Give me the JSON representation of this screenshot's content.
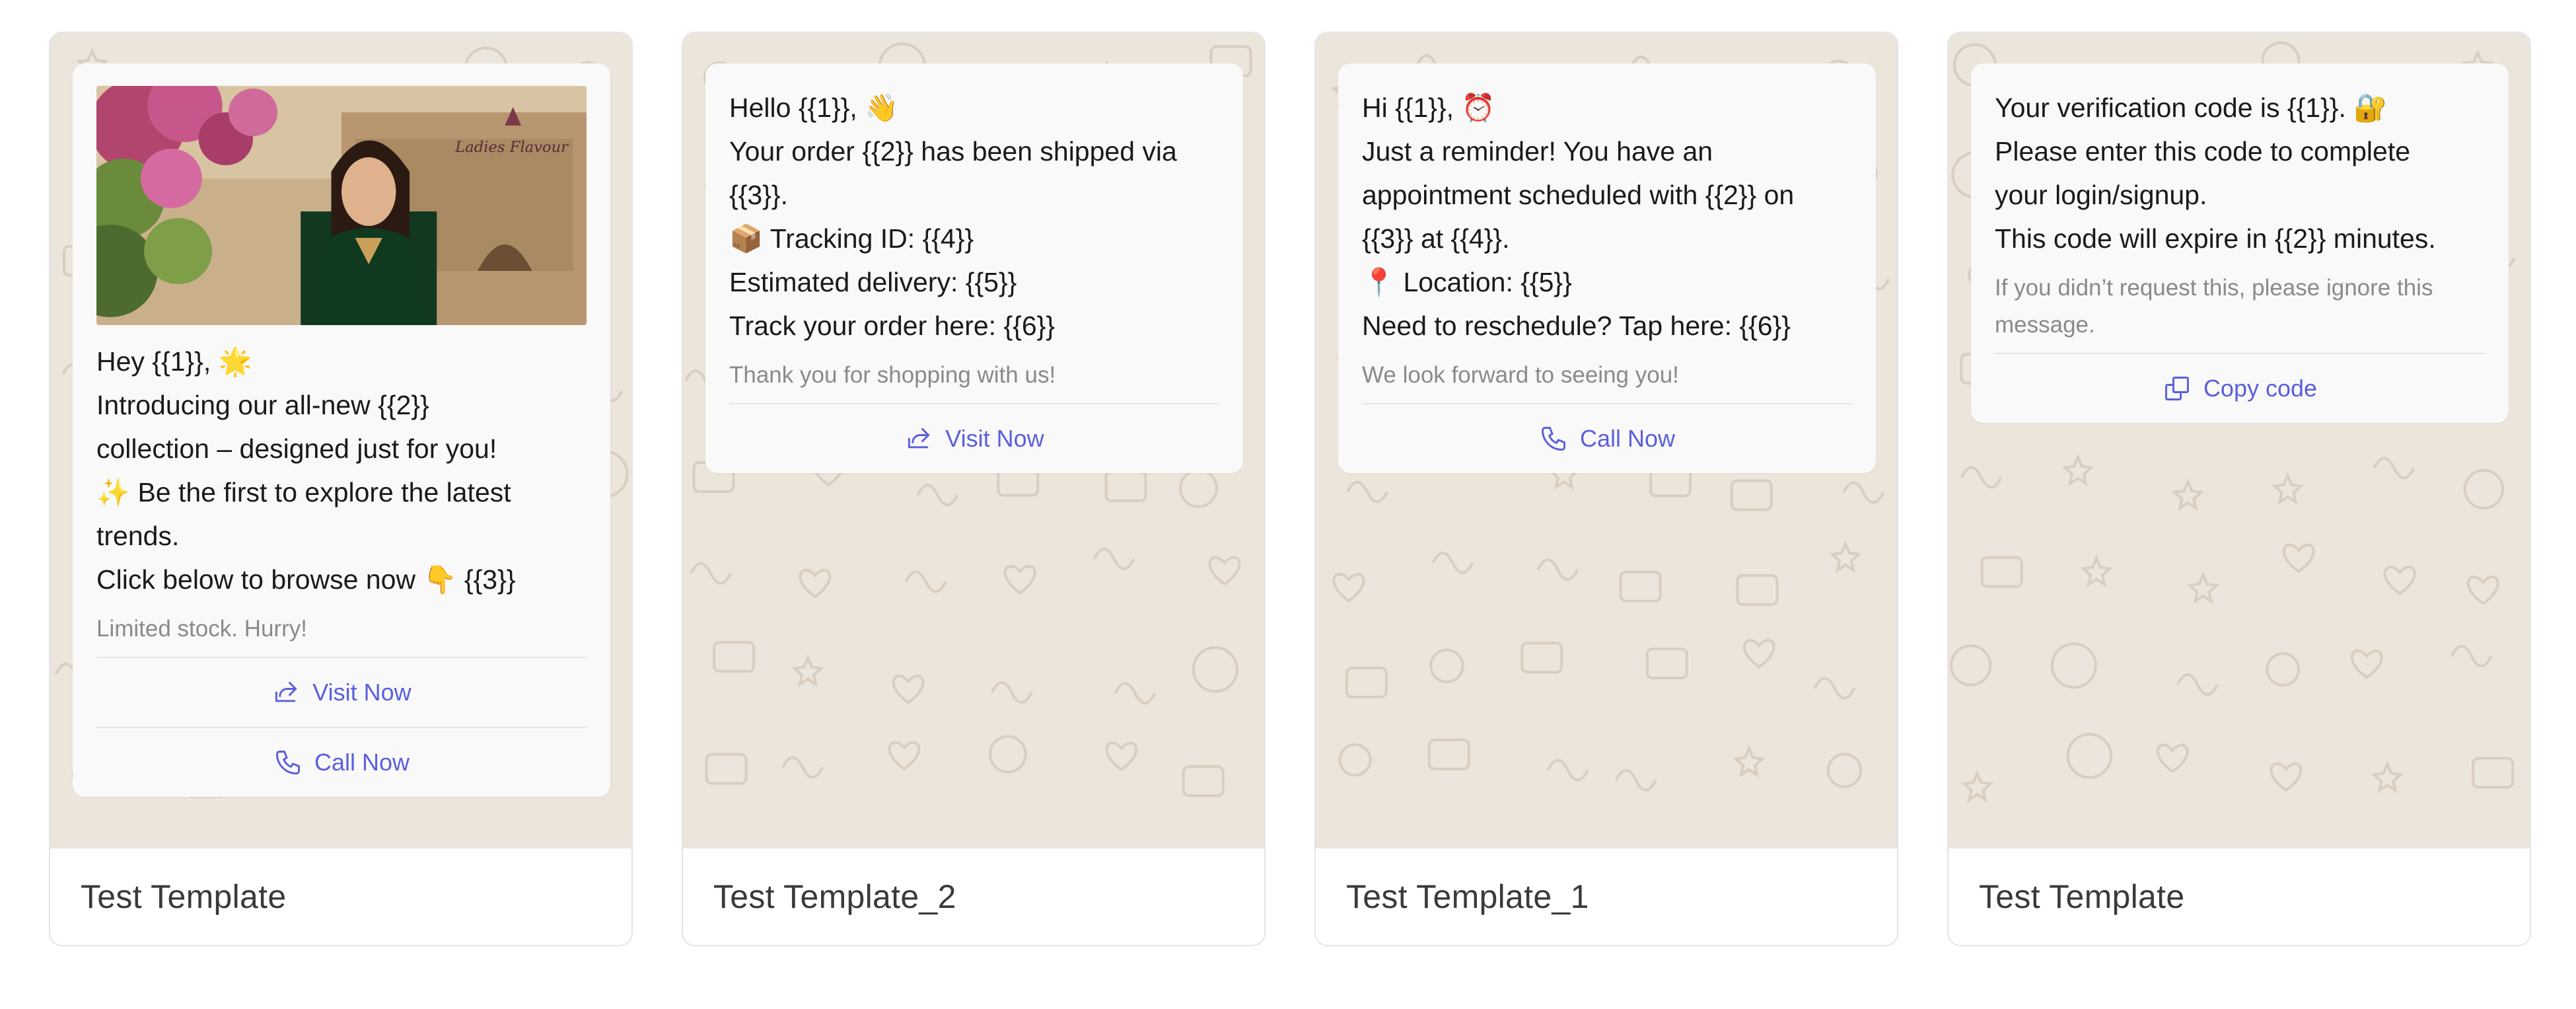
{
  "templates": [
    {
      "name": "Test Template",
      "has_image": true,
      "image_logo_text": "Ladies Flavour",
      "body": "Hey {{1}}, 🌟\nIntroducing our all-new {{2}}\ncollection – designed just for you!\n✨ Be the first to explore the latest\ntrends.\nClick below to browse now 👇 {{3}}",
      "footer": "Limited stock. Hurry!",
      "buttons": [
        {
          "label": "Visit Now",
          "icon": "external-link-icon"
        },
        {
          "label": "Call Now",
          "icon": "phone-icon"
        }
      ]
    },
    {
      "name": "Test Template_2",
      "has_image": false,
      "body": "Hello {{1}}, 👋\nYour order {{2}} has been shipped via\n{{3}}.\n📦 Tracking ID: {{4}}\nEstimated delivery: {{5}}\nTrack your order here: {{6}}",
      "footer": "Thank you for shopping with us!",
      "buttons": [
        {
          "label": "Visit Now",
          "icon": "external-link-icon"
        }
      ]
    },
    {
      "name": "Test Template_1",
      "has_image": false,
      "body": "Hi {{1}}, ⏰\nJust a reminder! You have an\nappointment scheduled with {{2}} on\n{{3}} at {{4}}.\n📍 Location: {{5}}\nNeed to reschedule? Tap here: {{6}}",
      "footer": "We look forward to seeing you!",
      "buttons": [
        {
          "label": "Call Now",
          "icon": "phone-icon"
        }
      ]
    },
    {
      "name": "Test Template",
      "has_image": false,
      "body": "Your verification code is {{1}}. 🔐\nPlease enter this code to complete\nyour login/signup.\nThis code will expire in {{2}} minutes.",
      "footer": "If you didn’t request this, please ignore this\nmessage.",
      "buttons": [
        {
          "label": "Copy code",
          "icon": "copy-icon"
        }
      ]
    }
  ],
  "colors": {
    "wallpaper": "#ece5dc",
    "button_text": "#5b5fdc",
    "bubble": "#f9f9f9"
  }
}
